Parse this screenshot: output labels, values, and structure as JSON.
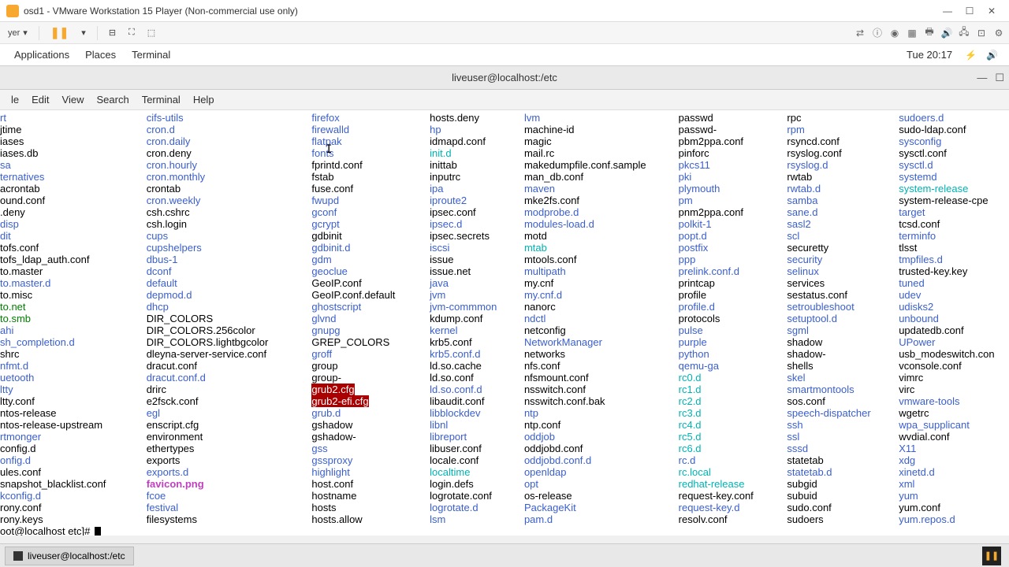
{
  "titlebar": {
    "title": "osd1 - VMware Workstation 15 Player (Non-commercial use only)"
  },
  "toolbar": {
    "player": "yer",
    "dropdown": "▾"
  },
  "gnome": {
    "applications": "Applications",
    "places": "Places",
    "terminal": "Terminal",
    "clock": "Tue 20:17"
  },
  "term_title": "liveuser@localhost:/etc",
  "term_menu": [
    "le",
    "Edit",
    "View",
    "Search",
    "Terminal",
    "Help"
  ],
  "prompt": "oot@localhost etc]# ",
  "taskbar": {
    "tab": "liveuser@localhost:/etc"
  },
  "cols": [
    [
      {
        "t": "rt",
        "c": "dir"
      },
      {
        "t": "jtime",
        "c": "file"
      },
      {
        "t": "iases",
        "c": "file"
      },
      {
        "t": "iases.db",
        "c": "file"
      },
      {
        "t": "sa",
        "c": "dir"
      },
      {
        "t": "ternatives",
        "c": "dir"
      },
      {
        "t": "acrontab",
        "c": "file"
      },
      {
        "t": "ound.conf",
        "c": "file"
      },
      {
        "t": ".deny",
        "c": "file"
      },
      {
        "t": "disp",
        "c": "dir"
      },
      {
        "t": "dit",
        "c": "dir"
      },
      {
        "t": "tofs.conf",
        "c": "file"
      },
      {
        "t": "tofs_ldap_auth.conf",
        "c": "file"
      },
      {
        "t": "to.master",
        "c": "file"
      },
      {
        "t": "to.master.d",
        "c": "dir"
      },
      {
        "t": "to.misc",
        "c": "file"
      },
      {
        "t": "to.net",
        "c": "exec"
      },
      {
        "t": "to.smb",
        "c": "exec"
      },
      {
        "t": "ahi",
        "c": "dir"
      },
      {
        "t": "sh_completion.d",
        "c": "dir"
      },
      {
        "t": "shrc",
        "c": "file"
      },
      {
        "t": "nfmt.d",
        "c": "dir"
      },
      {
        "t": "uetooth",
        "c": "dir"
      },
      {
        "t": "ltty",
        "c": "dir"
      },
      {
        "t": "ltty.conf",
        "c": "file"
      },
      {
        "t": "ntos-release",
        "c": "file"
      },
      {
        "t": "ntos-release-upstream",
        "c": "file"
      },
      {
        "t": "rtmonger",
        "c": "dir"
      },
      {
        "t": "config.d",
        "c": "file"
      },
      {
        "t": "onfig.d",
        "c": "dir"
      },
      {
        "t": "ules.conf",
        "c": "file"
      },
      {
        "t": "snapshot_blacklist.conf",
        "c": "file"
      },
      {
        "t": "kconfig.d",
        "c": "dir"
      },
      {
        "t": "rony.conf",
        "c": "file"
      },
      {
        "t": "rony.keys",
        "c": "file"
      }
    ],
    [
      {
        "t": "cifs-utils",
        "c": "dir"
      },
      {
        "t": "cron.d",
        "c": "dir"
      },
      {
        "t": "cron.daily",
        "c": "dir"
      },
      {
        "t": "cron.deny",
        "c": "file"
      },
      {
        "t": "cron.hourly",
        "c": "dir"
      },
      {
        "t": "cron.monthly",
        "c": "dir"
      },
      {
        "t": "crontab",
        "c": "file"
      },
      {
        "t": "cron.weekly",
        "c": "dir"
      },
      {
        "t": "csh.cshrc",
        "c": "file"
      },
      {
        "t": "csh.login",
        "c": "file"
      },
      {
        "t": "cups",
        "c": "dir"
      },
      {
        "t": "cupshelpers",
        "c": "dir"
      },
      {
        "t": "dbus-1",
        "c": "dir"
      },
      {
        "t": "dconf",
        "c": "dir"
      },
      {
        "t": "default",
        "c": "dir"
      },
      {
        "t": "depmod.d",
        "c": "dir"
      },
      {
        "t": "dhcp",
        "c": "dir"
      },
      {
        "t": "DIR_COLORS",
        "c": "file"
      },
      {
        "t": "DIR_COLORS.256color",
        "c": "file"
      },
      {
        "t": "DIR_COLORS.lightbgcolor",
        "c": "file"
      },
      {
        "t": "dleyna-server-service.conf",
        "c": "file"
      },
      {
        "t": "dracut.conf",
        "c": "file"
      },
      {
        "t": "dracut.conf.d",
        "c": "dir"
      },
      {
        "t": "drirc",
        "c": "file"
      },
      {
        "t": "e2fsck.conf",
        "c": "file"
      },
      {
        "t": "egl",
        "c": "dir"
      },
      {
        "t": "enscript.cfg",
        "c": "file"
      },
      {
        "t": "environment",
        "c": "file"
      },
      {
        "t": "ethertypes",
        "c": "file"
      },
      {
        "t": "exports",
        "c": "file"
      },
      {
        "t": "exports.d",
        "c": "dir"
      },
      {
        "t": "favicon.png",
        "c": "img"
      },
      {
        "t": "fcoe",
        "c": "dir"
      },
      {
        "t": "festival",
        "c": "dir"
      },
      {
        "t": "filesystems",
        "c": "file"
      }
    ],
    [
      {
        "t": "firefox",
        "c": "dir"
      },
      {
        "t": "firewalld",
        "c": "dir"
      },
      {
        "t": "flatpak",
        "c": "dir"
      },
      {
        "t": "fonts",
        "c": "dir"
      },
      {
        "t": "fprintd.conf",
        "c": "file"
      },
      {
        "t": "fstab",
        "c": "file"
      },
      {
        "t": "fuse.conf",
        "c": "file"
      },
      {
        "t": "fwupd",
        "c": "dir"
      },
      {
        "t": "gconf",
        "c": "dir"
      },
      {
        "t": "gcrypt",
        "c": "dir"
      },
      {
        "t": "gdbinit",
        "c": "file"
      },
      {
        "t": "gdbinit.d",
        "c": "dir"
      },
      {
        "t": "gdm",
        "c": "dir"
      },
      {
        "t": "geoclue",
        "c": "dir"
      },
      {
        "t": "GeoIP.conf",
        "c": "file"
      },
      {
        "t": "GeoIP.conf.default",
        "c": "file"
      },
      {
        "t": "ghostscript",
        "c": "dir"
      },
      {
        "t": "glvnd",
        "c": "dir"
      },
      {
        "t": "gnupg",
        "c": "dir"
      },
      {
        "t": "GREP_COLORS",
        "c": "file"
      },
      {
        "t": "groff",
        "c": "dir"
      },
      {
        "t": "group",
        "c": "file"
      },
      {
        "t": "group-",
        "c": "file"
      },
      {
        "t": "grub2.cfg",
        "c": "sel"
      },
      {
        "t": "grub2-efi.cfg",
        "c": "sel"
      },
      {
        "t": "grub.d",
        "c": "dir"
      },
      {
        "t": "gshadow",
        "c": "file"
      },
      {
        "t": "gshadow-",
        "c": "file"
      },
      {
        "t": "gss",
        "c": "dir"
      },
      {
        "t": "gssproxy",
        "c": "dir"
      },
      {
        "t": "highlight",
        "c": "dir"
      },
      {
        "t": "host.conf",
        "c": "file"
      },
      {
        "t": "hostname",
        "c": "file"
      },
      {
        "t": "hosts",
        "c": "file"
      },
      {
        "t": "hosts.allow",
        "c": "file"
      }
    ],
    [
      {
        "t": "hosts.deny",
        "c": "file"
      },
      {
        "t": "hp",
        "c": "dir"
      },
      {
        "t": "idmapd.conf",
        "c": "file"
      },
      {
        "t": "init.d",
        "c": "link"
      },
      {
        "t": "inittab",
        "c": "file"
      },
      {
        "t": "inputrc",
        "c": "file"
      },
      {
        "t": "ipa",
        "c": "dir"
      },
      {
        "t": "iproute2",
        "c": "dir"
      },
      {
        "t": "ipsec.conf",
        "c": "file"
      },
      {
        "t": "ipsec.d",
        "c": "dir"
      },
      {
        "t": "ipsec.secrets",
        "c": "file"
      },
      {
        "t": "iscsi",
        "c": "dir"
      },
      {
        "t": "issue",
        "c": "file"
      },
      {
        "t": "issue.net",
        "c": "file"
      },
      {
        "t": "java",
        "c": "dir"
      },
      {
        "t": "jvm",
        "c": "dir"
      },
      {
        "t": "jvm-commmon",
        "c": "dir"
      },
      {
        "t": "kdump.conf",
        "c": "file"
      },
      {
        "t": "kernel",
        "c": "dir"
      },
      {
        "t": "krb5.conf",
        "c": "file"
      },
      {
        "t": "krb5.conf.d",
        "c": "dir"
      },
      {
        "t": "ld.so.cache",
        "c": "file"
      },
      {
        "t": "ld.so.conf",
        "c": "file"
      },
      {
        "t": "ld.so.conf.d",
        "c": "dir"
      },
      {
        "t": "libaudit.conf",
        "c": "file"
      },
      {
        "t": "libblockdev",
        "c": "dir"
      },
      {
        "t": "libnl",
        "c": "dir"
      },
      {
        "t": "libreport",
        "c": "dir"
      },
      {
        "t": "libuser.conf",
        "c": "file"
      },
      {
        "t": "locale.conf",
        "c": "file"
      },
      {
        "t": "localtime",
        "c": "link"
      },
      {
        "t": "login.defs",
        "c": "file"
      },
      {
        "t": "logrotate.conf",
        "c": "file"
      },
      {
        "t": "logrotate.d",
        "c": "dir"
      },
      {
        "t": "lsm",
        "c": "dir"
      }
    ],
    [
      {
        "t": "lvm",
        "c": "dir"
      },
      {
        "t": "machine-id",
        "c": "file"
      },
      {
        "t": "magic",
        "c": "file"
      },
      {
        "t": "mail.rc",
        "c": "file"
      },
      {
        "t": "makedumpfile.conf.sample",
        "c": "file"
      },
      {
        "t": "man_db.conf",
        "c": "file"
      },
      {
        "t": "maven",
        "c": "dir"
      },
      {
        "t": "mke2fs.conf",
        "c": "file"
      },
      {
        "t": "modprobe.d",
        "c": "dir"
      },
      {
        "t": "modules-load.d",
        "c": "dir"
      },
      {
        "t": "motd",
        "c": "file"
      },
      {
        "t": "mtab",
        "c": "link"
      },
      {
        "t": "mtools.conf",
        "c": "file"
      },
      {
        "t": "multipath",
        "c": "dir"
      },
      {
        "t": "my.cnf",
        "c": "file"
      },
      {
        "t": "my.cnf.d",
        "c": "dir"
      },
      {
        "t": "nanorc",
        "c": "file"
      },
      {
        "t": "ndctl",
        "c": "dir"
      },
      {
        "t": "netconfig",
        "c": "file"
      },
      {
        "t": "NetworkManager",
        "c": "dir"
      },
      {
        "t": "networks",
        "c": "file"
      },
      {
        "t": "nfs.conf",
        "c": "file"
      },
      {
        "t": "nfsmount.conf",
        "c": "file"
      },
      {
        "t": "nsswitch.conf",
        "c": "file"
      },
      {
        "t": "nsswitch.conf.bak",
        "c": "file"
      },
      {
        "t": "ntp",
        "c": "dir"
      },
      {
        "t": "ntp.conf",
        "c": "file"
      },
      {
        "t": "oddjob",
        "c": "dir"
      },
      {
        "t": "oddjobd.conf",
        "c": "file"
      },
      {
        "t": "oddjobd.conf.d",
        "c": "dir"
      },
      {
        "t": "openldap",
        "c": "dir"
      },
      {
        "t": "opt",
        "c": "dir"
      },
      {
        "t": "os-release",
        "c": "file"
      },
      {
        "t": "PackageKit",
        "c": "dir"
      },
      {
        "t": "pam.d",
        "c": "dir"
      }
    ],
    [
      {
        "t": "passwd",
        "c": "file"
      },
      {
        "t": "passwd-",
        "c": "file"
      },
      {
        "t": "pbm2ppa.conf",
        "c": "file"
      },
      {
        "t": "pinforc",
        "c": "file"
      },
      {
        "t": "pkcs11",
        "c": "dir"
      },
      {
        "t": "pki",
        "c": "dir"
      },
      {
        "t": "plymouth",
        "c": "dir"
      },
      {
        "t": "pm",
        "c": "dir"
      },
      {
        "t": "pnm2ppa.conf",
        "c": "file"
      },
      {
        "t": "polkit-1",
        "c": "dir"
      },
      {
        "t": "popt.d",
        "c": "dir"
      },
      {
        "t": "postfix",
        "c": "dir"
      },
      {
        "t": "ppp",
        "c": "dir"
      },
      {
        "t": "prelink.conf.d",
        "c": "dir"
      },
      {
        "t": "printcap",
        "c": "file"
      },
      {
        "t": "profile",
        "c": "file"
      },
      {
        "t": "profile.d",
        "c": "dir"
      },
      {
        "t": "protocols",
        "c": "file"
      },
      {
        "t": "pulse",
        "c": "dir"
      },
      {
        "t": "purple",
        "c": "dir"
      },
      {
        "t": "python",
        "c": "dir"
      },
      {
        "t": "qemu-ga",
        "c": "dir"
      },
      {
        "t": "rc0.d",
        "c": "link"
      },
      {
        "t": "rc1.d",
        "c": "link"
      },
      {
        "t": "rc2.d",
        "c": "link"
      },
      {
        "t": "rc3.d",
        "c": "link"
      },
      {
        "t": "rc4.d",
        "c": "link"
      },
      {
        "t": "rc5.d",
        "c": "link"
      },
      {
        "t": "rc6.d",
        "c": "link"
      },
      {
        "t": "rc.d",
        "c": "dir"
      },
      {
        "t": "rc.local",
        "c": "link"
      },
      {
        "t": "redhat-release",
        "c": "link"
      },
      {
        "t": "request-key.conf",
        "c": "file"
      },
      {
        "t": "request-key.d",
        "c": "dir"
      },
      {
        "t": "resolv.conf",
        "c": "file"
      }
    ],
    [
      {
        "t": "rpc",
        "c": "file"
      },
      {
        "t": "rpm",
        "c": "dir"
      },
      {
        "t": "rsyncd.conf",
        "c": "file"
      },
      {
        "t": "rsyslog.conf",
        "c": "file"
      },
      {
        "t": "rsyslog.d",
        "c": "dir"
      },
      {
        "t": "rwtab",
        "c": "file"
      },
      {
        "t": "rwtab.d",
        "c": "dir"
      },
      {
        "t": "samba",
        "c": "dir"
      },
      {
        "t": "sane.d",
        "c": "dir"
      },
      {
        "t": "sasl2",
        "c": "dir"
      },
      {
        "t": "scl",
        "c": "dir"
      },
      {
        "t": "securetty",
        "c": "file"
      },
      {
        "t": "security",
        "c": "dir"
      },
      {
        "t": "selinux",
        "c": "dir"
      },
      {
        "t": "services",
        "c": "file"
      },
      {
        "t": "sestatus.conf",
        "c": "file"
      },
      {
        "t": "setroubleshoot",
        "c": "dir"
      },
      {
        "t": "setuptool.d",
        "c": "dir"
      },
      {
        "t": "sgml",
        "c": "dir"
      },
      {
        "t": "shadow",
        "c": "file"
      },
      {
        "t": "shadow-",
        "c": "file"
      },
      {
        "t": "shells",
        "c": "file"
      },
      {
        "t": "skel",
        "c": "dir"
      },
      {
        "t": "smartmontools",
        "c": "dir"
      },
      {
        "t": "sos.conf",
        "c": "file"
      },
      {
        "t": "speech-dispatcher",
        "c": "dir"
      },
      {
        "t": "ssh",
        "c": "dir"
      },
      {
        "t": "ssl",
        "c": "dir"
      },
      {
        "t": "sssd",
        "c": "dir"
      },
      {
        "t": "statetab",
        "c": "file"
      },
      {
        "t": "statetab.d",
        "c": "dir"
      },
      {
        "t": "subgid",
        "c": "file"
      },
      {
        "t": "subuid",
        "c": "file"
      },
      {
        "t": "sudo.conf",
        "c": "file"
      },
      {
        "t": "sudoers",
        "c": "file"
      }
    ],
    [
      {
        "t": "sudoers.d",
        "c": "dir"
      },
      {
        "t": "sudo-ldap.conf",
        "c": "file"
      },
      {
        "t": "sysconfig",
        "c": "dir"
      },
      {
        "t": "sysctl.conf",
        "c": "file"
      },
      {
        "t": "sysctl.d",
        "c": "dir"
      },
      {
        "t": "systemd",
        "c": "dir"
      },
      {
        "t": "system-release",
        "c": "link"
      },
      {
        "t": "system-release-cpe",
        "c": "file"
      },
      {
        "t": "target",
        "c": "dir"
      },
      {
        "t": "tcsd.conf",
        "c": "file"
      },
      {
        "t": "terminfo",
        "c": "dir"
      },
      {
        "t": "tlsst",
        "c": "file"
      },
      {
        "t": "tmpfiles.d",
        "c": "dir"
      },
      {
        "t": "trusted-key.key",
        "c": "file"
      },
      {
        "t": "tuned",
        "c": "dir"
      },
      {
        "t": "udev",
        "c": "dir"
      },
      {
        "t": "udisks2",
        "c": "dir"
      },
      {
        "t": "unbound",
        "c": "dir"
      },
      {
        "t": "updatedb.conf",
        "c": "file"
      },
      {
        "t": "UPower",
        "c": "dir"
      },
      {
        "t": "usb_modeswitch.con",
        "c": "file"
      },
      {
        "t": "vconsole.conf",
        "c": "file"
      },
      {
        "t": "vimrc",
        "c": "file"
      },
      {
        "t": "virc",
        "c": "file"
      },
      {
        "t": "vmware-tools",
        "c": "dir"
      },
      {
        "t": "wgetrc",
        "c": "file"
      },
      {
        "t": "wpa_supplicant",
        "c": "dir"
      },
      {
        "t": "wvdial.conf",
        "c": "file"
      },
      {
        "t": "X11",
        "c": "dir"
      },
      {
        "t": "xdg",
        "c": "dir"
      },
      {
        "t": "xinetd.d",
        "c": "dir"
      },
      {
        "t": "xml",
        "c": "dir"
      },
      {
        "t": "yum",
        "c": "dir"
      },
      {
        "t": "yum.conf",
        "c": "file"
      },
      {
        "t": "yum.repos.d",
        "c": "dir"
      }
    ]
  ]
}
